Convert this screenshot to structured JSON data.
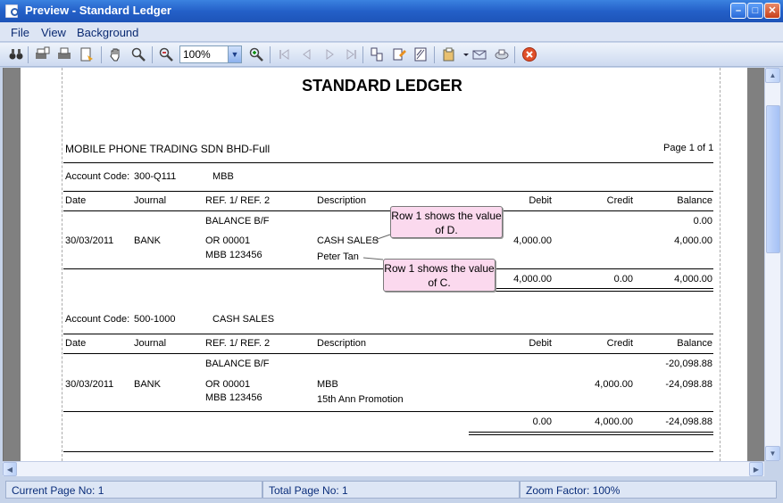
{
  "window": {
    "title": "Preview - Standard Ledger"
  },
  "menu": [
    "File",
    "View",
    "Background"
  ],
  "toolbar": {
    "zoom_value": "100%"
  },
  "report": {
    "title": "STANDARD LEDGER",
    "company": "MOBILE PHONE TRADING SDN  BHD-Full",
    "page_info": "Page 1 of 1",
    "column_headers": [
      "Date",
      "Journal",
      "REF. 1/ REF. 2",
      "Description",
      "Debit",
      "Credit",
      "Balance"
    ],
    "accounts": [
      {
        "code_label": "Account Code:",
        "code": "300-Q111",
        "name": "MBB",
        "opening_label": "BALANCE B/F",
        "opening_balance": "0.00",
        "txn": {
          "date": "30/03/2011",
          "journal": "BANK",
          "ref1": "OR 00001",
          "ref2": "MBB 123456",
          "desc1": "CASH SALES",
          "desc2": "Peter Tan",
          "debit": "4,000.00",
          "credit": "",
          "balance": "4,000.00"
        },
        "totals": {
          "debit": "4,000.00",
          "credit": "0.00",
          "balance": "4,000.00"
        }
      },
      {
        "code_label": "Account Code:",
        "code": "500-1000",
        "name": "CASH SALES",
        "opening_label": "BALANCE B/F",
        "opening_balance": "-20,098.88",
        "txn": {
          "date": "30/03/2011",
          "journal": "BANK",
          "ref1": "OR 00001",
          "ref2": "MBB 123456",
          "desc1": "MBB",
          "desc2": "15th Ann Promotion",
          "debit": "",
          "credit": "4,000.00",
          "balance": "-24,098.88"
        },
        "totals": {
          "debit": "0.00",
          "credit": "4,000.00",
          "balance": "-24,098.88"
        }
      }
    ]
  },
  "callouts": [
    {
      "text": "Row 1 shows the value of D."
    },
    {
      "text": "Row 1 shows the value of C."
    }
  ],
  "status": {
    "current_page": "Current Page No: 1",
    "total_page": "Total Page No: 1",
    "zoom_factor": "Zoom Factor: 100%"
  }
}
